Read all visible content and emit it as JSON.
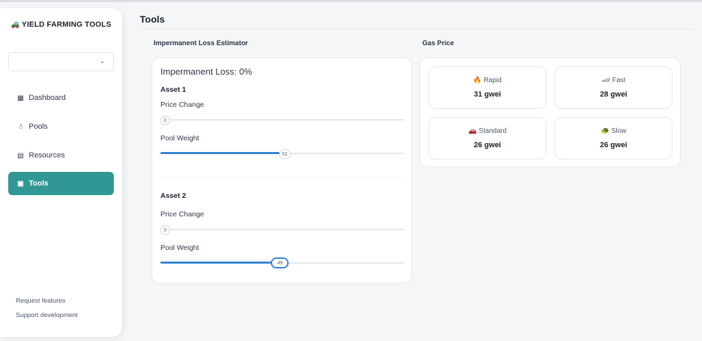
{
  "brand": {
    "icon": "🚜",
    "title": "YIELD FARMING TOOLS"
  },
  "sidebar": {
    "select_value": "",
    "items": [
      {
        "label": "Dashboard",
        "icon": "dashboard-icon"
      },
      {
        "label": "Pools",
        "icon": "pools-icon"
      },
      {
        "label": "Resources",
        "icon": "resources-icon"
      },
      {
        "label": "Tools",
        "icon": "toolbox-icon",
        "active": true
      }
    ],
    "footer": [
      "Request features",
      "Support development"
    ]
  },
  "page": {
    "title": "Tools"
  },
  "il": {
    "section_title": "Impermanent Loss Estimator",
    "heading": "Impermanent Loss: 0%",
    "assets": [
      {
        "title": "Asset 1",
        "price_label": "Price Change",
        "price_value": "0",
        "price_pct": 0,
        "weight_label": "Pool Weight",
        "weight_value": "51",
        "weight_pct": 51
      },
      {
        "title": "Asset 2",
        "price_label": "Price Change",
        "price_value": "0",
        "price_pct": 0,
        "weight_label": "Pool Weight",
        "weight_value": "49",
        "weight_pct": 49
      }
    ]
  },
  "gas": {
    "section_title": "Gas Price",
    "tiles": [
      {
        "emoji": "🔥",
        "label": "Rapid",
        "value": "31 gwei"
      },
      {
        "emoji": "🏎",
        "label": "Fast",
        "value": "28 gwei"
      },
      {
        "emoji": "🚗",
        "label": "Standard",
        "value": "26 gwei"
      },
      {
        "emoji": "🐢",
        "label": "Slow",
        "value": "26 gwei"
      }
    ]
  },
  "colors": {
    "accent": "#319795",
    "slider": "#3182ce"
  }
}
